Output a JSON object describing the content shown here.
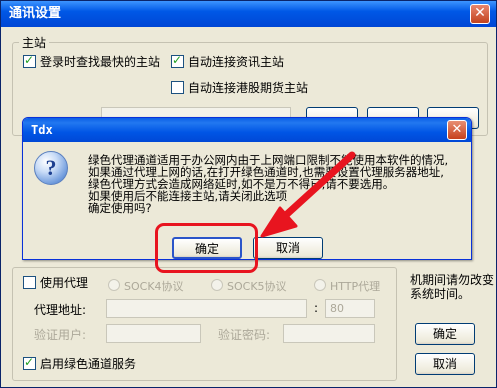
{
  "window": {
    "title": "通讯设置",
    "close": "✕"
  },
  "main_group": {
    "legend": "主站",
    "check_fastest": {
      "label": "登录时查找最快的主站",
      "checked": true
    },
    "check_auto_info": {
      "label": "自动连接资讯主站",
      "checked": true
    },
    "check_auto_hk": {
      "label": "自动连接港股期货主站",
      "checked": false
    }
  },
  "proxy_group": {
    "use_proxy": {
      "label": "使用代理",
      "checked": false
    },
    "radios": [
      "SOCK4协议",
      "SOCK5协议",
      "HTTP代理"
    ],
    "address_label": "代理地址:",
    "colon": ":",
    "port_value": "80",
    "user_label": "验证用户:",
    "password_label": "验证密码:",
    "green_channel": {
      "label": "启用绿色通道服务",
      "checked": true
    }
  },
  "side": {
    "text": "机期间请勿改变系统时间。",
    "ok_label": "确定",
    "cancel_label": "取消"
  },
  "dialog": {
    "title": "Tdx",
    "close": "✕",
    "icon_glyph": "?",
    "message": [
      "绿色代理通道适用于办公网内由于上网端口限制不能使用本软件的情况,",
      "如果通过代理上网的话,在打开绿色通道时,也需要设置代理服务器地址,",
      "绿色代理方式会造成网络延时,如不是万不得已,请不要选用。",
      "如果使用后不能连接主站,请关闭此选项",
      "确定使用吗?"
    ],
    "ok_label": "确定",
    "cancel_label": "取消"
  },
  "annotation": {
    "highlight_color": "#e8141f"
  }
}
